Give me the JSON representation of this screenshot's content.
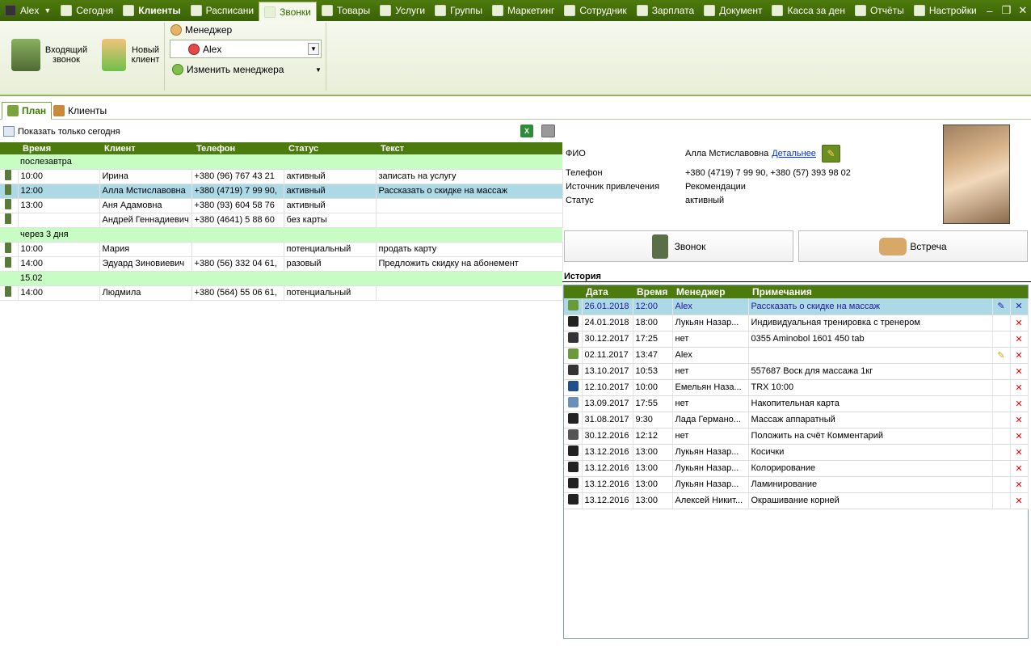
{
  "nav": {
    "user": "Alex",
    "items": [
      {
        "label": "Сегодня",
        "icon": "today-icon"
      },
      {
        "label": "Клиенты",
        "icon": "clients-icon"
      },
      {
        "label": "Расписани",
        "icon": "schedule-icon"
      },
      {
        "label": "Звонки",
        "icon": "calls-icon"
      },
      {
        "label": "Товары",
        "icon": "goods-icon"
      },
      {
        "label": "Услуги",
        "icon": "services-icon"
      },
      {
        "label": "Группы",
        "icon": "groups-icon"
      },
      {
        "label": "Маркетинг",
        "icon": "marketing-icon"
      },
      {
        "label": "Сотрудник",
        "icon": "staff-icon"
      },
      {
        "label": "Зарплата",
        "icon": "salary-icon"
      },
      {
        "label": "Документ",
        "icon": "document-icon"
      },
      {
        "label": "Касса за ден",
        "icon": "cashbox-icon"
      },
      {
        "label": "Отчёты",
        "icon": "reports-icon"
      },
      {
        "label": "Настройки",
        "icon": "settings-icon"
      }
    ]
  },
  "ribbon": {
    "incoming_call": "Входящий звонок",
    "new_client": "Новый клиент",
    "manager_label": "Менеджер",
    "manager_value": "Alex",
    "change_manager": "Изменить менеджера"
  },
  "tabs": {
    "plan": "План",
    "clients": "Клиенты"
  },
  "plan": {
    "show_today": "Показать только сегодня",
    "headers": [
      "Время",
      "Клиент",
      "Телефон",
      "Статус",
      "Текст"
    ],
    "rows": [
      {
        "group": "послезавтра"
      },
      {
        "time": "10:00",
        "client": "Ирина",
        "phone": "+380 (96) 767 43 21",
        "status": "активный",
        "text": "записать на услугу"
      },
      {
        "time": "12:00",
        "client": "Алла Мстиславовна",
        "phone": "+380 (4719) 7 99 90,",
        "status": "активный",
        "text": "Рассказать о скидке на массаж",
        "selected": true
      },
      {
        "time": "13:00",
        "client": "Аня Адамовна",
        "phone": "+380 (93) 604 58 76",
        "status": "активный",
        "text": ""
      },
      {
        "time": "",
        "client": "Андрей Геннадиевич",
        "phone": "+380 (4641) 5 88 60",
        "status": "без карты",
        "text": ""
      },
      {
        "group": "через 3 дня"
      },
      {
        "time": "10:00",
        "client": "Мария",
        "phone": "",
        "status": "потенциальный",
        "text": "продать карту"
      },
      {
        "time": "14:00",
        "client": "Эдуард Зиновиевич",
        "phone": "+380 (56) 332 04 61,",
        "status": "разовый",
        "text": "Предложить скидку на абонемент"
      },
      {
        "group": "15.02"
      },
      {
        "time": "14:00",
        "client": "Людмила",
        "phone": "+380 (564) 55 06 61,",
        "status": "потенциальный",
        "text": ""
      }
    ]
  },
  "details": {
    "fio_label": "ФИО",
    "fio": "Алла Мстиславовна",
    "details_link": "Детальнее",
    "phone_label": "Телефон",
    "phone": "+380 (4719) 7 99 90, +380 (57) 393 98 02",
    "source_label": "Источник привлечения",
    "source": "Рекомендации",
    "status_label": "Статус",
    "status": "активный",
    "call_button": "Звонок",
    "meeting_button": "Встреча"
  },
  "history": {
    "title": "История",
    "headers": [
      "Дата",
      "Время",
      "Менеджер",
      "Примечания"
    ],
    "rows": [
      {
        "icon": "call-icon",
        "date": "26.01.2018",
        "time": "12:00",
        "manager": "Alex",
        "note": "Рассказать о скидке на массаж",
        "editable": true,
        "selected": true
      },
      {
        "icon": "visit-icon",
        "date": "24.01.2018",
        "time": "18:00",
        "manager": "Лукьян Назар...",
        "note": "Индивидуальная тренировка с тренером",
        "editable": false
      },
      {
        "icon": "product-icon",
        "date": "30.12.2017",
        "time": "17:25",
        "manager": "нет",
        "note": "0355 Aminobol 1601 450 tab",
        "editable": false
      },
      {
        "icon": "call-icon",
        "date": "02.11.2017",
        "time": "13:47",
        "manager": "Alex",
        "note": "",
        "editable": true
      },
      {
        "icon": "product-icon",
        "date": "13.10.2017",
        "time": "10:53",
        "manager": "нет",
        "note": "557687 Воск для массажа 1кг",
        "editable": false
      },
      {
        "icon": "group-icon",
        "date": "12.10.2017",
        "time": "10:00",
        "manager": "Емельян Наза...",
        "note": "TRX 10:00",
        "editable": false
      },
      {
        "icon": "card-icon",
        "date": "13.09.2017",
        "time": "17:55",
        "manager": "нет",
        "note": "Накопительная карта",
        "editable": false
      },
      {
        "icon": "visit-icon",
        "date": "31.08.2017",
        "time": "9:30",
        "manager": "Лада Германо...",
        "note": "Массаж аппаратный",
        "editable": false
      },
      {
        "icon": "payment-icon",
        "date": "30.12.2016",
        "time": "12:12",
        "manager": "нет",
        "note": "Положить на счёт Комментарий",
        "editable": false
      },
      {
        "icon": "visit-icon",
        "date": "13.12.2016",
        "time": "13:00",
        "manager": "Лукьян Назар...",
        "note": "Косички",
        "editable": false
      },
      {
        "icon": "visit-icon",
        "date": "13.12.2016",
        "time": "13:00",
        "manager": "Лукьян Назар...",
        "note": "Колорирование",
        "editable": false
      },
      {
        "icon": "visit-icon",
        "date": "13.12.2016",
        "time": "13:00",
        "manager": "Лукьян Назар...",
        "note": "Ламинирование",
        "editable": false
      },
      {
        "icon": "visit-icon",
        "date": "13.12.2016",
        "time": "13:00",
        "manager": "Алексей Никит...",
        "note": "Окрашивание корней",
        "editable": false
      }
    ]
  },
  "colors": {
    "brand": "#4d7a0d",
    "selected_row": "#add8e6",
    "group_row": "#c7fdc2"
  }
}
